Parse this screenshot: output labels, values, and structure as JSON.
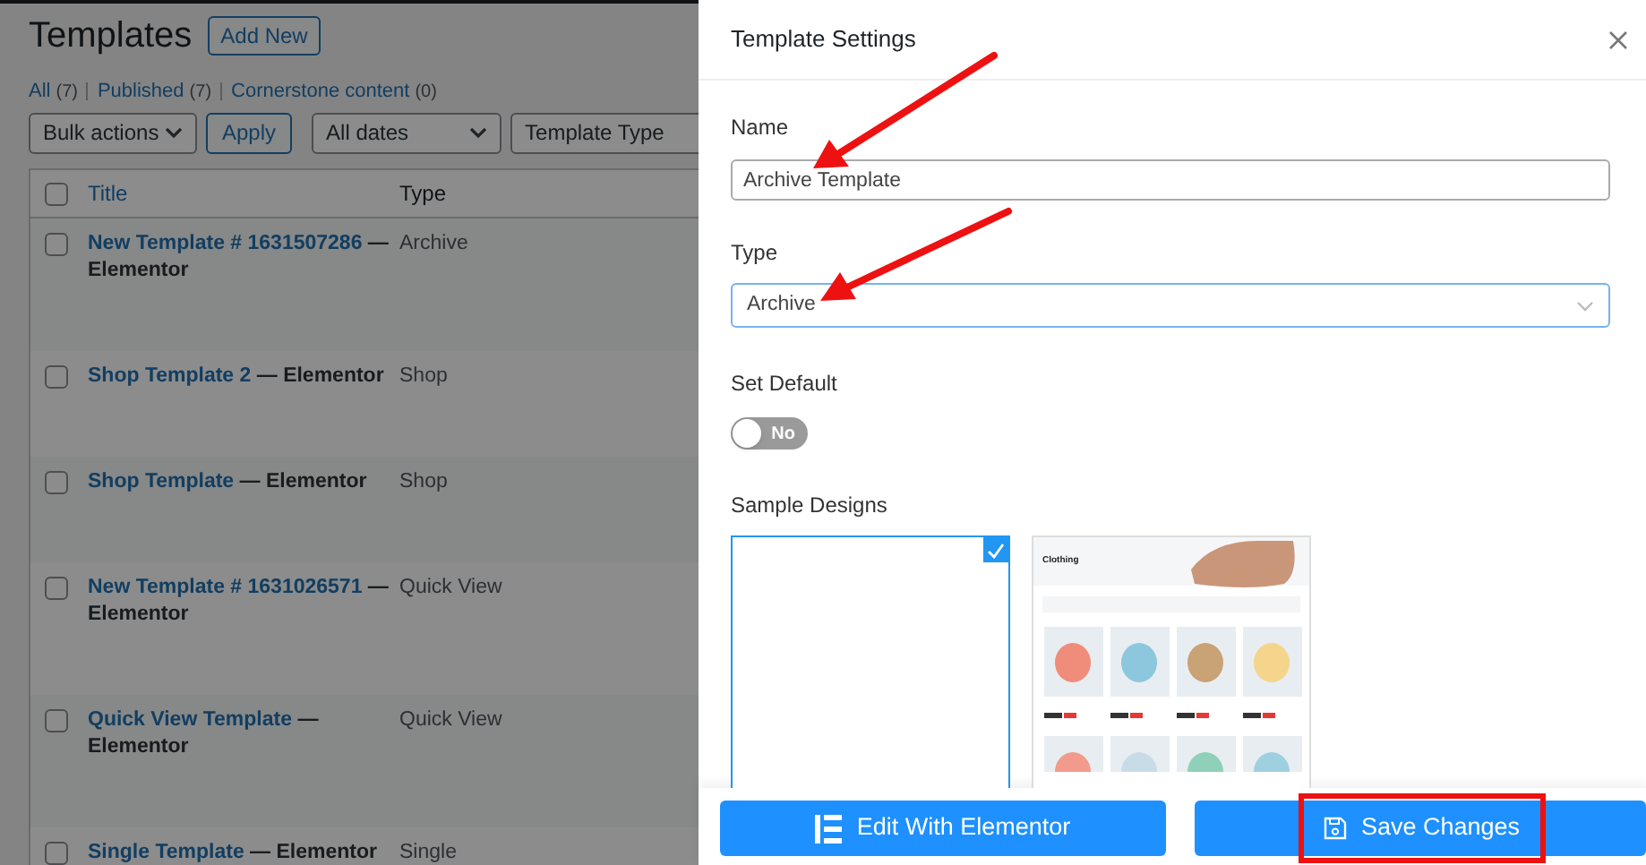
{
  "list_page": {
    "title": "Templates",
    "add_new": "Add New",
    "views": [
      {
        "label": "All",
        "count": "(7)"
      },
      {
        "label": "Published",
        "count": "(7)"
      },
      {
        "label": "Cornerstone content",
        "count": "(0)"
      }
    ],
    "bulk_actions": "Bulk actions",
    "apply": "Apply",
    "date_filter": "All dates",
    "type_filter": "Template Type",
    "table": {
      "all_checked": false,
      "columns": [
        "Title",
        "Type"
      ],
      "rows": [
        {
          "checked": false,
          "title": "New Template # 1631507286",
          "editor": "— Elementor",
          "type": "Archive"
        },
        {
          "checked": false,
          "title": "Shop Template 2",
          "editor": "— Elementor",
          "type": "Shop"
        },
        {
          "checked": false,
          "title": "Shop Template",
          "editor": "— Elementor",
          "type": "Shop"
        },
        {
          "checked": false,
          "title": "New Template # 1631026571",
          "editor": "— Elementor",
          "type": "Quick View"
        },
        {
          "checked": false,
          "title": "Quick View Template",
          "editor": "— Elementor",
          "type": "Quick View"
        },
        {
          "checked": false,
          "title": "Single Template",
          "editor": "— Elementor",
          "type": "Single"
        }
      ]
    }
  },
  "settings_panel": {
    "title": "Template Settings",
    "name": {
      "label": "Name",
      "value": "Archive Template"
    },
    "type": {
      "label": "Type",
      "value": "Archive"
    },
    "set_default": {
      "label": "Set Default",
      "on": false,
      "text": "No"
    },
    "sample_designs": {
      "label": "Sample Designs",
      "designs": [
        {
          "kind": "blank",
          "selected": true
        },
        {
          "kind": "preview",
          "title": "Clothing",
          "selected": false
        }
      ]
    },
    "buttons": [
      {
        "label": "Edit With Elementor",
        "highlighted": false
      },
      {
        "label": "Save Changes",
        "highlighted": true
      }
    ]
  }
}
